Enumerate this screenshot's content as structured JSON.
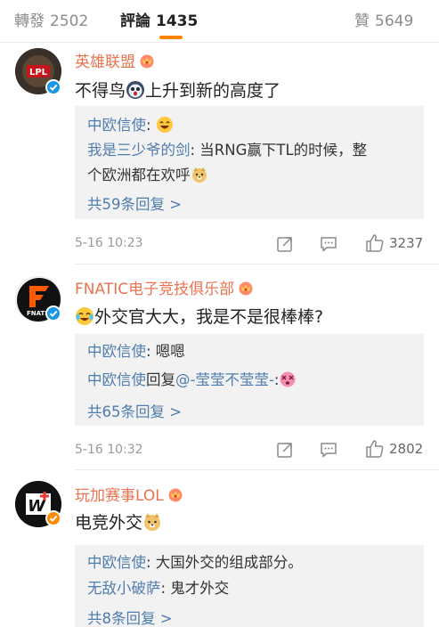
{
  "tabs": {
    "repost": {
      "label": "轉發",
      "count": "2502"
    },
    "comments": {
      "label": "評論",
      "count": "1435"
    },
    "likes": {
      "label": "贊",
      "count": "5649"
    }
  },
  "comments": [
    {
      "username": "英雄联盟",
      "avatar_text": "LPL",
      "text_before": "不得鸟",
      "text_after": "上升到新的高度了",
      "replies": [
        {
          "user": "中欧信使",
          "text": ":"
        },
        {
          "user": "我是三少爷的剑",
          "text": ": 当RNG赢下TL的时候，整",
          "text2": "个欧洲都在欢呼"
        }
      ],
      "more": "共59条回复 >",
      "time": "5-16 10:23",
      "likes": "3237"
    },
    {
      "username": "FNATIC电子竞技俱乐部",
      "avatar_text": "FNATIC",
      "text": "外交官大大，我是不是很棒棒?",
      "replies": [
        {
          "user": "中欧信使",
          "text": ": 嗯嗯"
        },
        {
          "user": "中欧信使",
          "text": "回复",
          "mention": "@-莹莹不莹莹-",
          "text_after": ":"
        }
      ],
      "more": "共65条回复 >",
      "time": "5-16 10:32",
      "likes": "2802"
    },
    {
      "username": "玩加赛事LOL",
      "avatar_text": "W",
      "text": "电竞外交",
      "replies": [
        {
          "user": "中欧信使",
          "text": ": 大国外交的组成部分。"
        },
        {
          "user": "无敌小破萨",
          "text": ": 鬼才外交"
        }
      ],
      "more": "共8条回复 >",
      "time": "",
      "likes": ""
    }
  ],
  "colors": {
    "accent": "#ff8200",
    "username": "#eb7350",
    "link": "#507daf",
    "verified_blue": "#1a96e6",
    "verified_orange": "#ff8a00"
  }
}
